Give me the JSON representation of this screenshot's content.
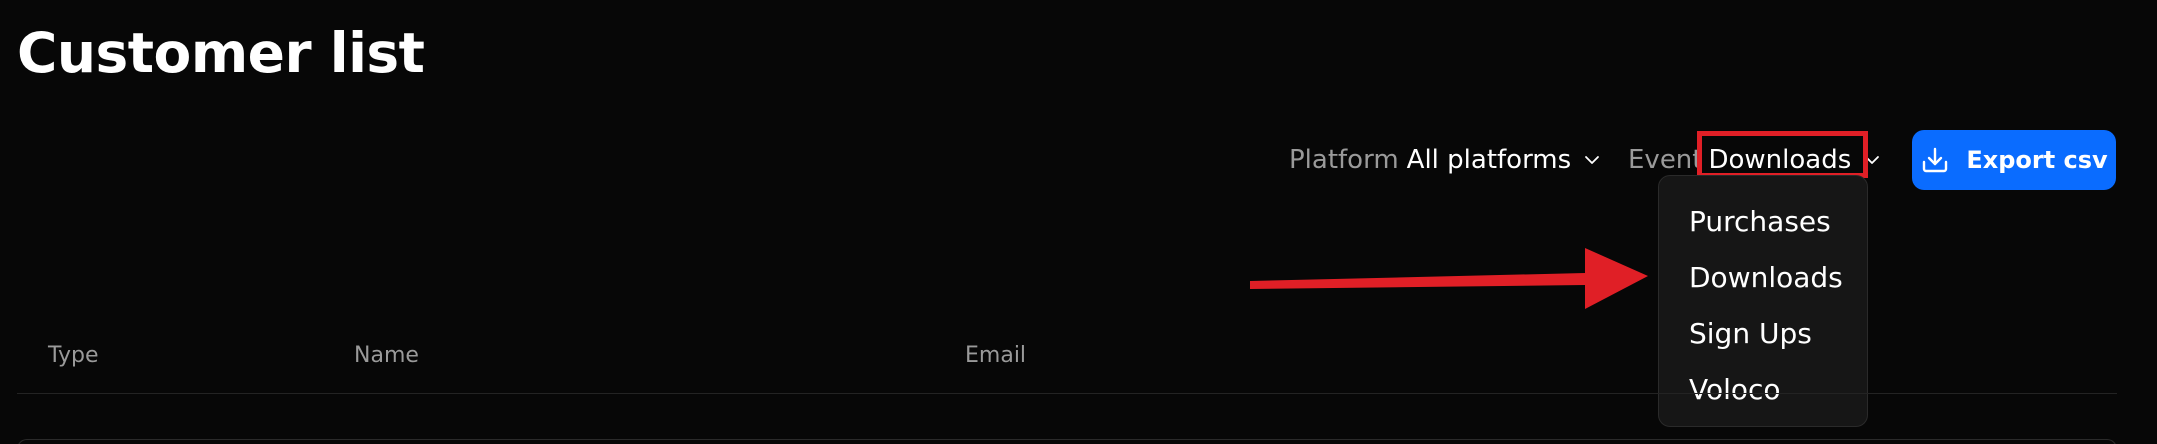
{
  "page": {
    "title": "Customer list"
  },
  "filters": {
    "platform": {
      "label": "Platform",
      "value": "All platforms"
    },
    "event": {
      "label": "Event",
      "value": "Downloads"
    }
  },
  "export_button": {
    "label": "Export csv",
    "icon": "download-icon"
  },
  "event_dropdown": {
    "options": [
      "Purchases",
      "Downloads",
      "Sign Ups",
      "Voloco"
    ]
  },
  "table": {
    "columns": [
      "Type",
      "Name",
      "Email"
    ]
  },
  "colors": {
    "background": "#070707",
    "accent": "#0a6cff",
    "annotation": "#e01f26"
  }
}
